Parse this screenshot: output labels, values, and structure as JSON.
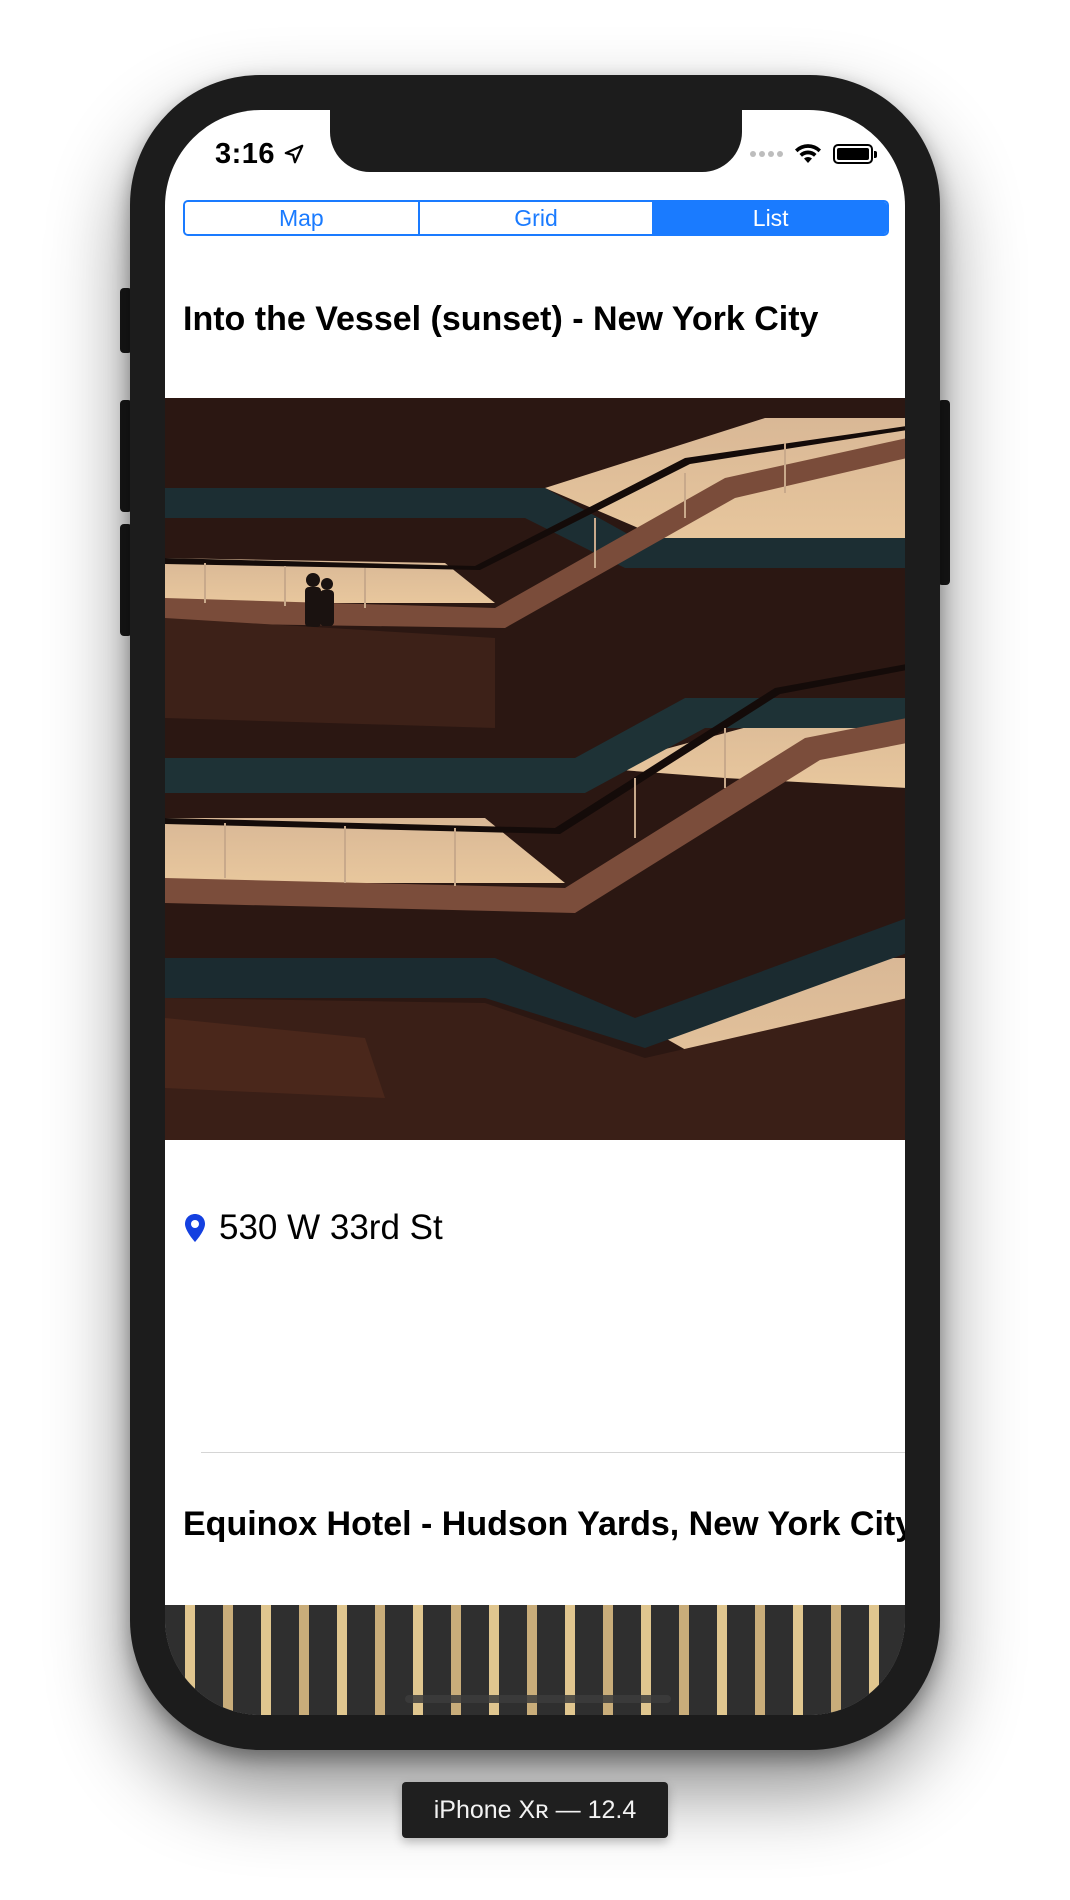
{
  "status_bar": {
    "time": "3:16"
  },
  "segmented_control": {
    "segments": [
      {
        "label": "Map",
        "selected": false
      },
      {
        "label": "Grid",
        "selected": false
      },
      {
        "label": "List",
        "selected": true
      }
    ]
  },
  "list": {
    "items": [
      {
        "title": "Into the Vessel (sunset) - New York City",
        "address": "530 W 33rd St"
      },
      {
        "title": "Equinox Hotel - Hudson Yards, New York City"
      }
    ]
  },
  "device_label": "iPhone Xʀ — 12.4",
  "colors": {
    "accent": "#1a7bff",
    "pin": "#1440e0"
  }
}
